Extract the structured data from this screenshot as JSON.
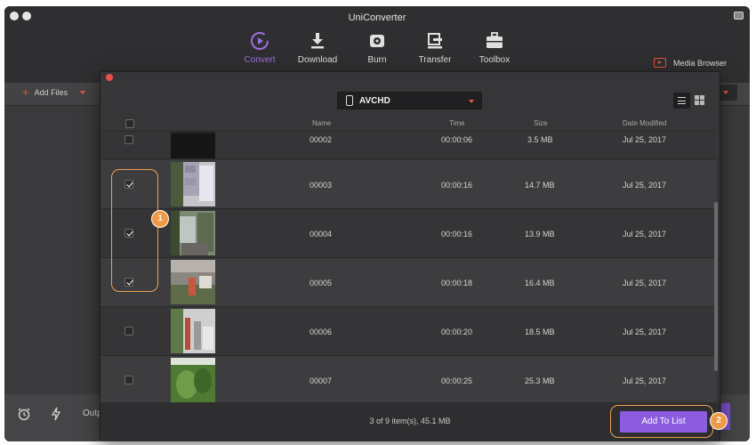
{
  "app": {
    "title": "UniConverter",
    "nav": [
      {
        "label": "Convert",
        "icon": "play-circle-icon",
        "active": true
      },
      {
        "label": "Download",
        "icon": "download-icon",
        "active": false
      },
      {
        "label": "Burn",
        "icon": "disc-icon",
        "active": false
      },
      {
        "label": "Transfer",
        "icon": "transfer-icon",
        "active": false
      },
      {
        "label": "Toolbox",
        "icon": "toolbox-icon",
        "active": false
      }
    ],
    "media_browser": "Media Browser",
    "add_files": "Add Files",
    "output_label": "Outp"
  },
  "dialog": {
    "format": "AVCHD",
    "columns": {
      "name": "Name",
      "time": "Time",
      "size": "Size",
      "date": "Date Modified"
    },
    "rows": [
      {
        "name": "00002",
        "time": "00:00:06",
        "size": "3.5 MB",
        "date": "Jul 25, 2017",
        "checked": false
      },
      {
        "name": "00003",
        "time": "00:00:16",
        "size": "14.7 MB",
        "date": "Jul 25, 2017",
        "checked": true
      },
      {
        "name": "00004",
        "time": "00:00:16",
        "size": "13.9 MB",
        "date": "Jul 25, 2017",
        "checked": true
      },
      {
        "name": "00005",
        "time": "00:00:18",
        "size": "16.4 MB",
        "date": "Jul 25, 2017",
        "checked": true
      },
      {
        "name": "00006",
        "time": "00:00:20",
        "size": "18.5 MB",
        "date": "Jul 25, 2017",
        "checked": false
      },
      {
        "name": "00007",
        "time": "00:00:25",
        "size": "25.3 MB",
        "date": "Jul 25, 2017",
        "checked": false
      }
    ],
    "summary": "3 of 9 item(s), 45.1 MB",
    "add_button": "Add To List"
  },
  "annotations": {
    "step1": "1",
    "step2": "2"
  },
  "colors": {
    "accent": "#8c5ce0",
    "annotation": "#ef9a45",
    "close": "#f24a4a"
  }
}
